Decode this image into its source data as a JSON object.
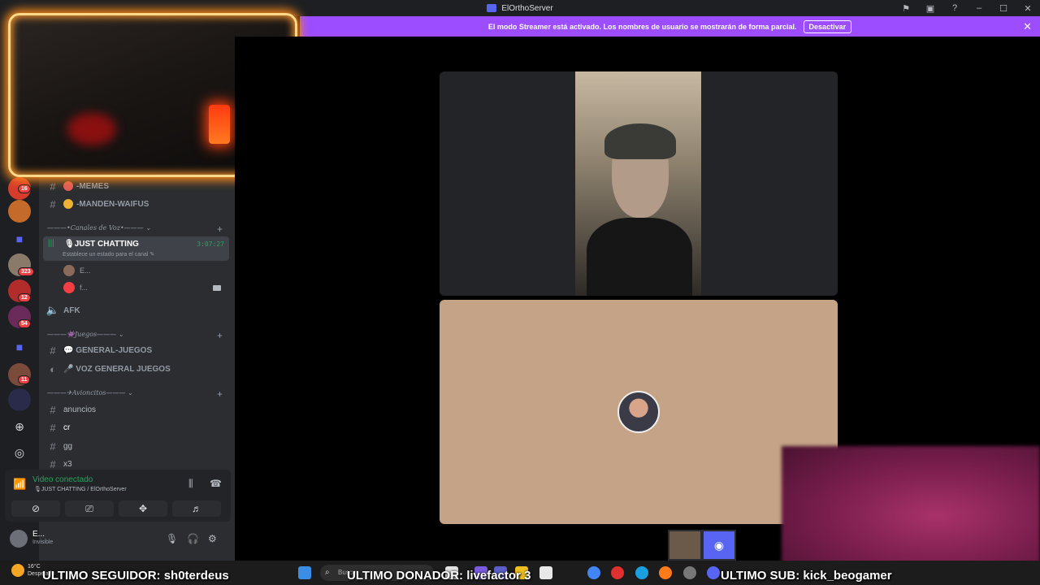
{
  "titlebar": {
    "title": "ElOrthoServer"
  },
  "banner": {
    "text": "El modo Streamer está activado. Los nombres de usuario se mostrarán de forma parcial.",
    "button": "Desactivar",
    "close": "✕"
  },
  "servers": {
    "badges": [
      "16",
      "323",
      "12",
      "54",
      "11"
    ]
  },
  "channels": {
    "memes": "-MEMES",
    "manden_waifus": "-MANDEN-WAIFUS",
    "cat_voz": "———•Canales de Voz•———",
    "just_chatting": "🎙JUST CHATTING",
    "just_chatting_time": "3:07:27",
    "just_chatting_status": "Establece un estado para el canal ✎",
    "voice_user_1": "E...",
    "voice_user_2": "f...",
    "afk": "AFK",
    "cat_juegos": "———👾Juegos———",
    "general_juegos": "💬 GENERAL-JUEGOS",
    "voz_general": "🎤 VOZ GENERAL JUEGOS",
    "cat_avioncitos": "———✈Avioncitos———",
    "anuncios": "anuncios",
    "cr": "cr",
    "gg": "gg",
    "x3": "x3"
  },
  "voice_panel": {
    "status": "Video conectado",
    "location": "🎙JUST CHATTING / ElOrthoServer"
  },
  "user": {
    "name": "E...",
    "status": "Invisible"
  },
  "taskbar": {
    "temp": "16°C",
    "weather": "Despejado",
    "search_placeholder": "Buscar"
  },
  "overlay": {
    "seguidor": "ULTIMO SEGUIDOR: sh0terdeus",
    "donador": "ULTIMO DONADOR: livefactor 3",
    "sub": "ULTIMO SUB: kick_beogamer"
  },
  "colors": {
    "banner": "#9b4dff",
    "connected": "#23a55a",
    "mention": "#f23f43"
  }
}
